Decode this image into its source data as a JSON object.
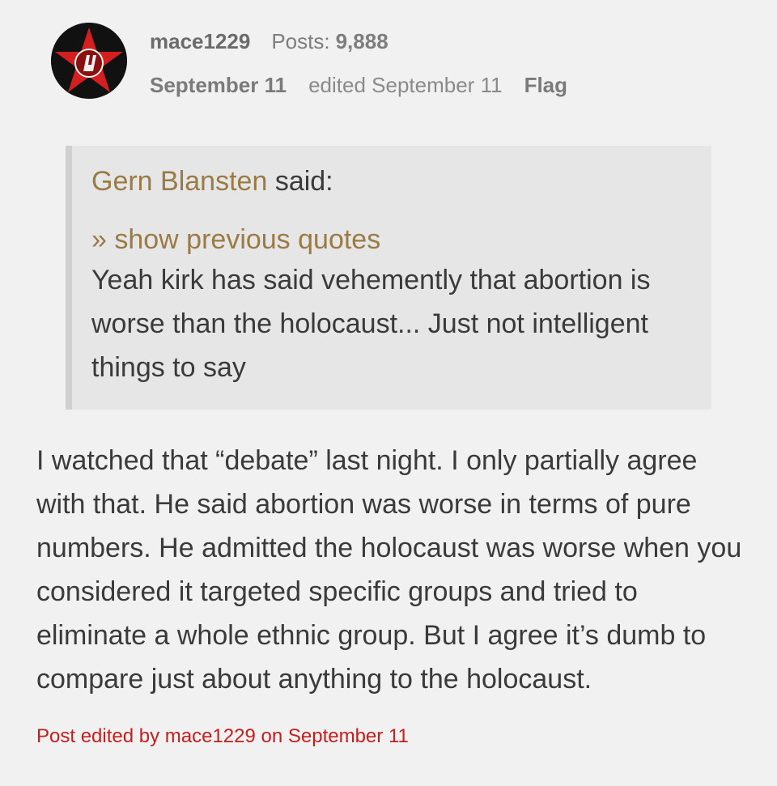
{
  "post": {
    "author": {
      "username": "mace1229",
      "posts_label": "Posts:",
      "posts_count": "9,888",
      "avatar_icon": "red-star-logo-icon"
    },
    "date": "September 11",
    "edited": "edited September 11",
    "flag_label": "Flag",
    "quote": {
      "author": "Gern Blansten",
      "said_label": "said:",
      "show_previous": "» show previous quotes",
      "text": "Yeah kirk has said vehemently that abortion is worse than the holocaust... Just not intelligent things to say"
    },
    "body": "I watched that “debate” last night. I only partially agree with that. He said abortion was worse in terms of pure numbers. He admitted the holocaust was worse when you considered it targeted specific groups and tried to eliminate a whole ethnic group. But I agree it’s dumb to compare just about anything to the holocaust.",
    "edit_note": "Post edited by mace1229 on September 11"
  },
  "colors": {
    "background": "#f1f1f1",
    "quote_background": "#e6e6e6",
    "quote_link": "#9a7a45",
    "edit_note": "#c41e1e",
    "text": "#3a3a3a"
  }
}
